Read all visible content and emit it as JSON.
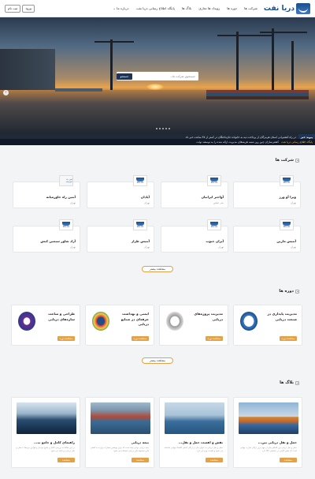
{
  "header": {
    "logo_text": "دریا نفت",
    "nav": [
      "شرکت ها",
      "دوره ها",
      "رویداد ها تجاری",
      "بلاگ ها",
      "پایگاه اطلاع رسانی دریا نفت",
      "درباره ما"
    ],
    "more_label": "درباره ما ⌄",
    "login_label": "ورود",
    "register_label": "ثبت نام"
  },
  "hero": {
    "search_placeholder": "جستجوی شرکت ها...",
    "search_button": "جستجو",
    "prev_arrow": "‹"
  },
  "ticker": {
    "badge": "پیوند خبر",
    "text": "در راه کشتیرانی استان هرمزگان از پرداخت دیه به خانواده جان‌باختگان در کمتر از ۴۸ ساعت خبر داد",
    "highlight": "پایگاه اطلاع رسانی دریا نفت",
    "text2": "کشتی‌سازان چین روز شنبه هزینه‌های مدیریت ارائه شده را به توسعه دولت"
  },
  "companies": {
    "title": "شرکت ها",
    "logo_caption": "SEA OIL",
    "items": [
      {
        "name": "ویرا آو ورژ",
        "loc": "تهران"
      },
      {
        "name": "آواختر ایرانیان",
        "loc": "بندر عباس"
      },
      {
        "name": "آپادان",
        "loc": "تهران"
      },
      {
        "name": "آبتین راه خاورمیانه",
        "loc": "تهران"
      },
      {
        "name": "آبتیس مارین",
        "loc": "تهران"
      },
      {
        "name": "آیران جنوب",
        "loc": "تهران"
      },
      {
        "name": "آبتیس طراز",
        "loc": "تهران"
      },
      {
        "name": "آزاد شاور سیمین کیش",
        "loc": "تهران"
      }
    ],
    "first_badge": "آبتین راه خاورمیانه",
    "more": "مشاهده بیشتر"
  },
  "courses": {
    "title": "دوره ها",
    "items": [
      {
        "name": "مدیریت پایداری در صنعت دریایی",
        "btn": "مشاهده دوره"
      },
      {
        "name": "مدیریت پروژه‌های دریایی",
        "btn": "مشاهده دوره"
      },
      {
        "name": "ایمنی و بهداشت حرفه‌ای در صنایع دریایی",
        "btn": "مشاهده دوره"
      },
      {
        "name": "طراحی و ساخت سازه‌های دریایی",
        "btn": "مشاهده دوره"
      }
    ],
    "more": "مشاهده بیشتر"
  },
  "blogs": {
    "title": "بلاگ ها",
    "items": [
      {
        "title": "حمل و نقل دریایی بین...",
        "desc": "حمل و نقل دریایی بین المللی یکی از مهم ترین ارکان تجارت جهانی است که نقش کلیدی در جابجایی کالا دارد",
        "btn": "مشاهده"
      },
      {
        "title": "نقش و اهمیت حمل و نقل...",
        "desc": "حمل و نقل دریایی به عنوان یکی از ارکان اصلی اقتصاد جهانی شناخته می شود و اهمیت ویژه ای دارد",
        "btn": "مشاهده"
      },
      {
        "title": "بیمه دریایی",
        "desc": "بیمه دریایی نوعی بیمه است که برای پوشش خسارات وارده به کشتی ها و محموله های دریایی استفاده می شود",
        "btn": "مشاهده"
      },
      {
        "title": "راهنمای کامل و جامع ب...",
        "desc": "در این مقاله به بررسی کامل و جامع مراحل و قوانین مرتبط با حمل و نقل دریایی پرداخته می شود",
        "btn": "مشاهده"
      }
    ]
  }
}
